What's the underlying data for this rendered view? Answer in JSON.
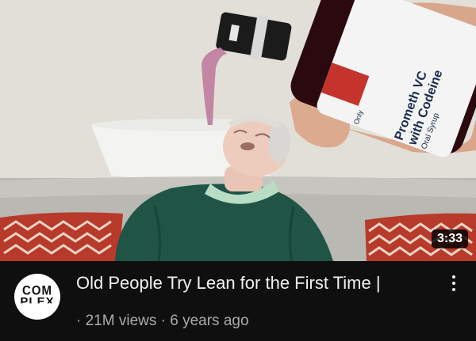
{
  "video": {
    "duration": "3:33",
    "bottle_label": {
      "line1": "Prometh VC",
      "line2": "with Codeine",
      "line3": "Oral Syrup",
      "only": "Only"
    }
  },
  "channel": {
    "avatar_line1": "COM",
    "avatar_line2": "PLEX"
  },
  "title": "Old People Try Lean for the First Time |",
  "meta": {
    "views": "21M views",
    "separator": "·",
    "age": "6 years ago"
  },
  "colors": {
    "background": "#0f0f0f",
    "title": "#f1f1f1",
    "meta": "#aaaaaa",
    "sweater": "#1f5446",
    "liquid": "#c07fa0",
    "pillow": "#b83a2a"
  }
}
